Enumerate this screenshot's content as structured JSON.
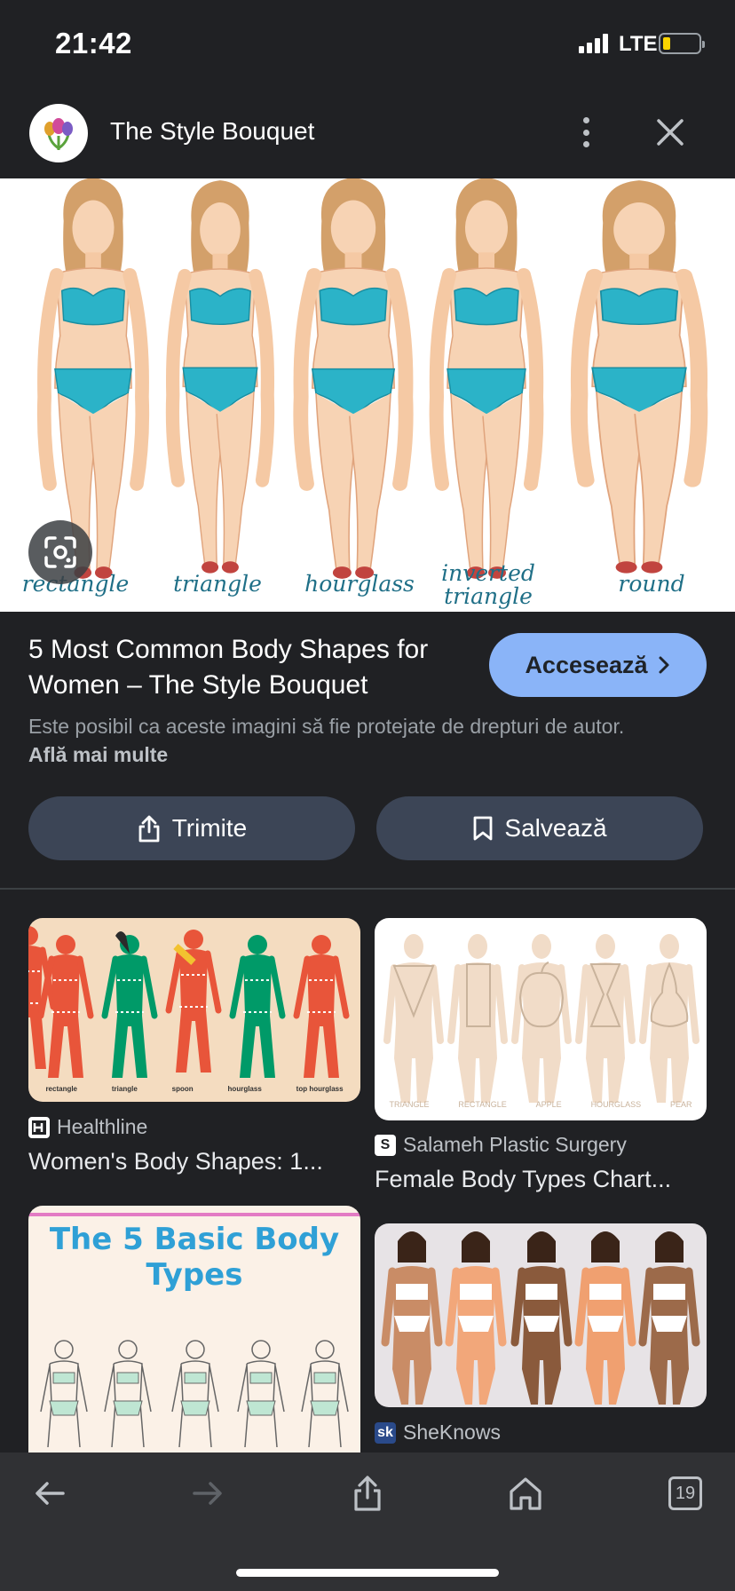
{
  "status_bar": {
    "time": "21:42",
    "network": "LTE"
  },
  "header": {
    "site_name": "The Style Bouquet",
    "logo_icon": "tulip-bouquet-icon"
  },
  "hero": {
    "shape_labels": [
      "rectangle",
      "triangle",
      "hourglass",
      "inverted triangle",
      "round"
    ]
  },
  "result": {
    "title": "5 Most Common Body Shapes for Women – The Style Bouquet",
    "visit_label": "Accesează",
    "copyright_text": "Este posibil ca aceste imagini să fie protejate de drepturi de autor.",
    "learn_more": "Află mai multe",
    "share_label": "Trimite",
    "save_label": "Salvează"
  },
  "related": [
    {
      "source": "Healthline",
      "title": "Women's Body Shapes: 1...",
      "labels": [
        "rectangle",
        "triangle",
        "spoon",
        "hourglass",
        "top hourglass"
      ]
    },
    {
      "source": "Salameh Plastic Surgery",
      "title": "Female Body Types Chart...",
      "labels": [
        "TRIANGLE",
        "RECTANGLE",
        "APPLE",
        "HOURGLASS",
        "PEAR"
      ]
    },
    {
      "heading": "The 5 Basic Body Types"
    },
    {
      "source": "SheKnows"
    }
  ],
  "toolbar": {
    "tab_count": "19"
  },
  "colors": {
    "accent": "#8ab4f8",
    "background": "#202124",
    "button": "#3c4556",
    "swimsuit": "#2bb3c8"
  }
}
